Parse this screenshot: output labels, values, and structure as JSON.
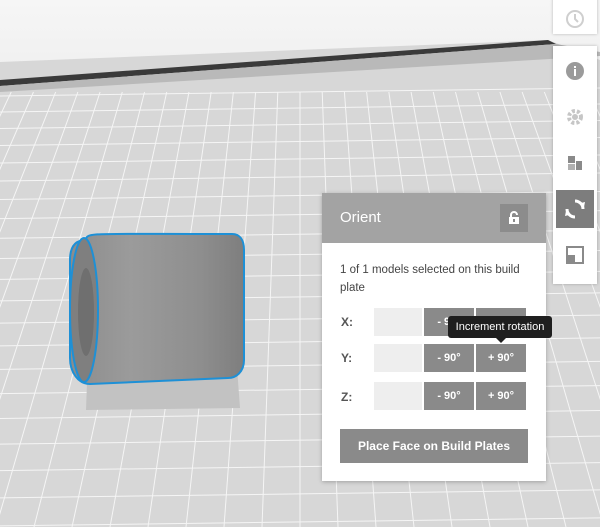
{
  "panel": {
    "title": "Orient",
    "info_text": "1 of 1 models selected on this build plate",
    "axes": [
      {
        "label": "X:",
        "minus": "- 90°",
        "plus": "+ 90°"
      },
      {
        "label": "Y:",
        "minus": "- 90°",
        "plus": "+ 90°"
      },
      {
        "label": "Z:",
        "minus": "- 90°",
        "plus": "+ 90°"
      }
    ],
    "place_button": "Place Face on Build Plates"
  },
  "tooltip": {
    "text": "Increment rotation"
  },
  "toolbar": {
    "items": [
      "history-icon",
      "info-icon",
      "settings-icon",
      "arrange-icon",
      "orient-icon",
      "scale-icon"
    ],
    "active": "orient-icon"
  },
  "colors": {
    "selection_outline": "#1e90d6",
    "panel_header": "#a3a3a3",
    "button": "#8a8a8a",
    "grid_floor": "#d7d7d7"
  }
}
